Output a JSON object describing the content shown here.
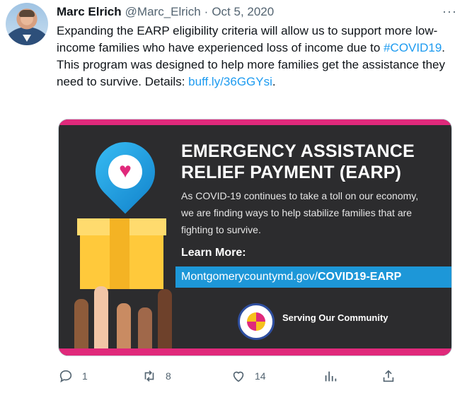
{
  "tweet": {
    "author_name": "Marc Elrich",
    "handle": "@Marc_Elrich",
    "separator": "·",
    "date": "Oct 5, 2020",
    "more_label": "···",
    "text_part1": "Expanding the EARP eligibility criteria will allow us to support more low-income families who have experienced loss of income due to ",
    "hashtag": "#COVID19",
    "text_part2": ". This program was designed to help more families get the assistance they need to survive. Details: ",
    "link": "buff.ly/36GGYsi",
    "text_end": "."
  },
  "media": {
    "title_line1": "EMERGENCY ASSISTANCE",
    "title_line2": "RELIEF PAYMENT (EARP)",
    "description": "As COVID-19 continues to take a toll on our economy, we are finding ways to help stabilize families that are fighting to survive.",
    "learn_more": "Learn More:",
    "url_prefix": "Montgomerycountymd.gov/",
    "url_bold": "COVID19-EARP",
    "serving": "Serving Our Community",
    "colors": {
      "magenta": "#e0297b",
      "blue": "#1d97d8",
      "background": "#2c2c2e",
      "box": "#ffc93b"
    }
  },
  "actions": {
    "replies": "1",
    "retweets": "8",
    "likes": "14",
    "icons": [
      "reply-icon",
      "retweet-icon",
      "like-icon",
      "analytics-icon",
      "share-icon"
    ]
  }
}
